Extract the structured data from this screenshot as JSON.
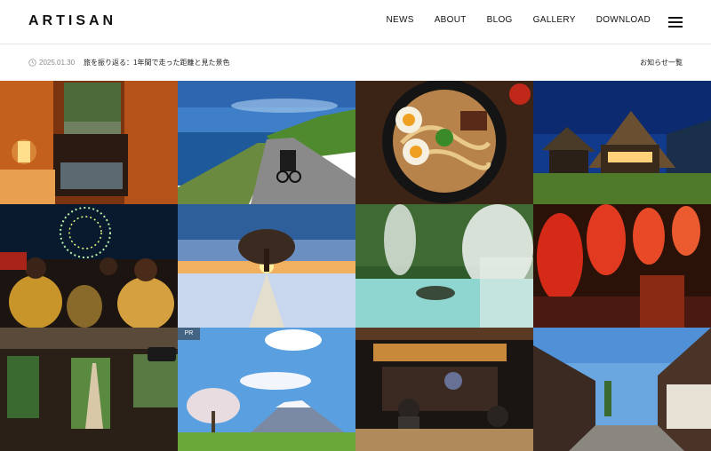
{
  "header": {
    "logo": "ARTISAN",
    "nav": [
      "NEWS",
      "ABOUT",
      "BLOG",
      "GALLERY",
      "DOWNLOAD"
    ]
  },
  "news": {
    "date": "2025.01.30",
    "title": "旅を振り返る：1年間で走った距離と見た景色",
    "all_link": "お知らせ一覧"
  },
  "gallery": {
    "tiles": [
      {
        "subject": "onsen-room"
      },
      {
        "subject": "coastal-road-bicycle"
      },
      {
        "subject": "ramen-bowl"
      },
      {
        "subject": "thatched-houses-night"
      },
      {
        "subject": "festival-fireworks"
      },
      {
        "subject": "sunset-tree-snow"
      },
      {
        "subject": "hot-spring-steam"
      },
      {
        "subject": "red-lanterns-street"
      },
      {
        "subject": "train-cab-view"
      },
      {
        "subject": "cherry-tree-mountain",
        "badge": "PR"
      },
      {
        "subject": "izakaya-stall"
      },
      {
        "subject": "old-town-street"
      }
    ]
  }
}
